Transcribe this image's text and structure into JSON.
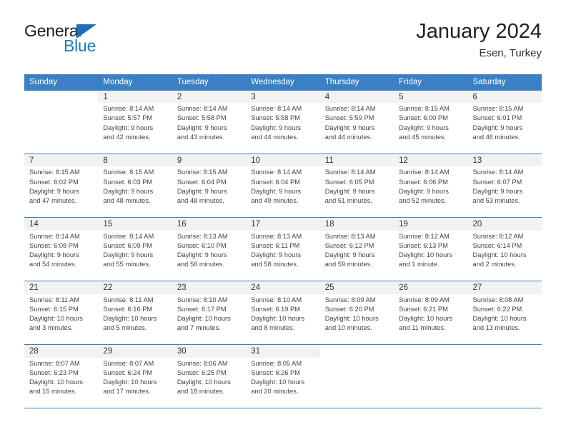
{
  "brand": {
    "name_primary": "General",
    "name_secondary": "Blue",
    "triangle_icon": "triangle-icon",
    "accent_color": "#1d79c4"
  },
  "header": {
    "title": "January 2024",
    "subtitle": "Esen, Turkey"
  },
  "colors": {
    "header_blue": "#3b80c4",
    "daynum_bg": "#f2f2f2",
    "text": "#444444"
  },
  "calendar": {
    "weekday_headers": [
      "Sunday",
      "Monday",
      "Tuesday",
      "Wednesday",
      "Thursday",
      "Friday",
      "Saturday"
    ],
    "weeks": [
      [
        {
          "day": "",
          "sunrise": "",
          "sunset": "",
          "daylight_line1": "",
          "daylight_line2": ""
        },
        {
          "day": "1",
          "sunrise": "Sunrise: 8:14 AM",
          "sunset": "Sunset: 5:57 PM",
          "daylight_line1": "Daylight: 9 hours",
          "daylight_line2": "and 42 minutes."
        },
        {
          "day": "2",
          "sunrise": "Sunrise: 8:14 AM",
          "sunset": "Sunset: 5:58 PM",
          "daylight_line1": "Daylight: 9 hours",
          "daylight_line2": "and 43 minutes."
        },
        {
          "day": "3",
          "sunrise": "Sunrise: 8:14 AM",
          "sunset": "Sunset: 5:58 PM",
          "daylight_line1": "Daylight: 9 hours",
          "daylight_line2": "and 44 minutes."
        },
        {
          "day": "4",
          "sunrise": "Sunrise: 8:14 AM",
          "sunset": "Sunset: 5:59 PM",
          "daylight_line1": "Daylight: 9 hours",
          "daylight_line2": "and 44 minutes."
        },
        {
          "day": "5",
          "sunrise": "Sunrise: 8:15 AM",
          "sunset": "Sunset: 6:00 PM",
          "daylight_line1": "Daylight: 9 hours",
          "daylight_line2": "and 45 minutes."
        },
        {
          "day": "6",
          "sunrise": "Sunrise: 8:15 AM",
          "sunset": "Sunset: 6:01 PM",
          "daylight_line1": "Daylight: 9 hours",
          "daylight_line2": "and 46 minutes."
        }
      ],
      [
        {
          "day": "7",
          "sunrise": "Sunrise: 8:15 AM",
          "sunset": "Sunset: 6:02 PM",
          "daylight_line1": "Daylight: 9 hours",
          "daylight_line2": "and 47 minutes."
        },
        {
          "day": "8",
          "sunrise": "Sunrise: 8:15 AM",
          "sunset": "Sunset: 6:03 PM",
          "daylight_line1": "Daylight: 9 hours",
          "daylight_line2": "and 48 minutes."
        },
        {
          "day": "9",
          "sunrise": "Sunrise: 8:15 AM",
          "sunset": "Sunset: 6:04 PM",
          "daylight_line1": "Daylight: 9 hours",
          "daylight_line2": "and 48 minutes."
        },
        {
          "day": "10",
          "sunrise": "Sunrise: 8:14 AM",
          "sunset": "Sunset: 6:04 PM",
          "daylight_line1": "Daylight: 9 hours",
          "daylight_line2": "and 49 minutes."
        },
        {
          "day": "11",
          "sunrise": "Sunrise: 8:14 AM",
          "sunset": "Sunset: 6:05 PM",
          "daylight_line1": "Daylight: 9 hours",
          "daylight_line2": "and 51 minutes."
        },
        {
          "day": "12",
          "sunrise": "Sunrise: 8:14 AM",
          "sunset": "Sunset: 6:06 PM",
          "daylight_line1": "Daylight: 9 hours",
          "daylight_line2": "and 52 minutes."
        },
        {
          "day": "13",
          "sunrise": "Sunrise: 8:14 AM",
          "sunset": "Sunset: 6:07 PM",
          "daylight_line1": "Daylight: 9 hours",
          "daylight_line2": "and 53 minutes."
        }
      ],
      [
        {
          "day": "14",
          "sunrise": "Sunrise: 8:14 AM",
          "sunset": "Sunset: 6:08 PM",
          "daylight_line1": "Daylight: 9 hours",
          "daylight_line2": "and 54 minutes."
        },
        {
          "day": "15",
          "sunrise": "Sunrise: 8:14 AM",
          "sunset": "Sunset: 6:09 PM",
          "daylight_line1": "Daylight: 9 hours",
          "daylight_line2": "and 55 minutes."
        },
        {
          "day": "16",
          "sunrise": "Sunrise: 8:13 AM",
          "sunset": "Sunset: 6:10 PM",
          "daylight_line1": "Daylight: 9 hours",
          "daylight_line2": "and 56 minutes."
        },
        {
          "day": "17",
          "sunrise": "Sunrise: 8:13 AM",
          "sunset": "Sunset: 6:11 PM",
          "daylight_line1": "Daylight: 9 hours",
          "daylight_line2": "and 58 minutes."
        },
        {
          "day": "18",
          "sunrise": "Sunrise: 8:13 AM",
          "sunset": "Sunset: 6:12 PM",
          "daylight_line1": "Daylight: 9 hours",
          "daylight_line2": "and 59 minutes."
        },
        {
          "day": "19",
          "sunrise": "Sunrise: 8:12 AM",
          "sunset": "Sunset: 6:13 PM",
          "daylight_line1": "Daylight: 10 hours",
          "daylight_line2": "and 1 minute."
        },
        {
          "day": "20",
          "sunrise": "Sunrise: 8:12 AM",
          "sunset": "Sunset: 6:14 PM",
          "daylight_line1": "Daylight: 10 hours",
          "daylight_line2": "and 2 minutes."
        }
      ],
      [
        {
          "day": "21",
          "sunrise": "Sunrise: 8:11 AM",
          "sunset": "Sunset: 6:15 PM",
          "daylight_line1": "Daylight: 10 hours",
          "daylight_line2": "and 3 minutes."
        },
        {
          "day": "22",
          "sunrise": "Sunrise: 8:11 AM",
          "sunset": "Sunset: 6:16 PM",
          "daylight_line1": "Daylight: 10 hours",
          "daylight_line2": "and 5 minutes."
        },
        {
          "day": "23",
          "sunrise": "Sunrise: 8:10 AM",
          "sunset": "Sunset: 6:17 PM",
          "daylight_line1": "Daylight: 10 hours",
          "daylight_line2": "and 7 minutes."
        },
        {
          "day": "24",
          "sunrise": "Sunrise: 8:10 AM",
          "sunset": "Sunset: 6:19 PM",
          "daylight_line1": "Daylight: 10 hours",
          "daylight_line2": "and 8 minutes."
        },
        {
          "day": "25",
          "sunrise": "Sunrise: 8:09 AM",
          "sunset": "Sunset: 6:20 PM",
          "daylight_line1": "Daylight: 10 hours",
          "daylight_line2": "and 10 minutes."
        },
        {
          "day": "26",
          "sunrise": "Sunrise: 8:09 AM",
          "sunset": "Sunset: 6:21 PM",
          "daylight_line1": "Daylight: 10 hours",
          "daylight_line2": "and 11 minutes."
        },
        {
          "day": "27",
          "sunrise": "Sunrise: 8:08 AM",
          "sunset": "Sunset: 6:22 PM",
          "daylight_line1": "Daylight: 10 hours",
          "daylight_line2": "and 13 minutes."
        }
      ],
      [
        {
          "day": "28",
          "sunrise": "Sunrise: 8:07 AM",
          "sunset": "Sunset: 6:23 PM",
          "daylight_line1": "Daylight: 10 hours",
          "daylight_line2": "and 15 minutes."
        },
        {
          "day": "29",
          "sunrise": "Sunrise: 8:07 AM",
          "sunset": "Sunset: 6:24 PM",
          "daylight_line1": "Daylight: 10 hours",
          "daylight_line2": "and 17 minutes."
        },
        {
          "day": "30",
          "sunrise": "Sunrise: 8:06 AM",
          "sunset": "Sunset: 6:25 PM",
          "daylight_line1": "Daylight: 10 hours",
          "daylight_line2": "and 18 minutes."
        },
        {
          "day": "31",
          "sunrise": "Sunrise: 8:05 AM",
          "sunset": "Sunset: 6:26 PM",
          "daylight_line1": "Daylight: 10 hours",
          "daylight_line2": "and 20 minutes."
        },
        {
          "day": "",
          "sunrise": "",
          "sunset": "",
          "daylight_line1": "",
          "daylight_line2": ""
        },
        {
          "day": "",
          "sunrise": "",
          "sunset": "",
          "daylight_line1": "",
          "daylight_line2": ""
        },
        {
          "day": "",
          "sunrise": "",
          "sunset": "",
          "daylight_line1": "",
          "daylight_line2": ""
        }
      ]
    ]
  }
}
